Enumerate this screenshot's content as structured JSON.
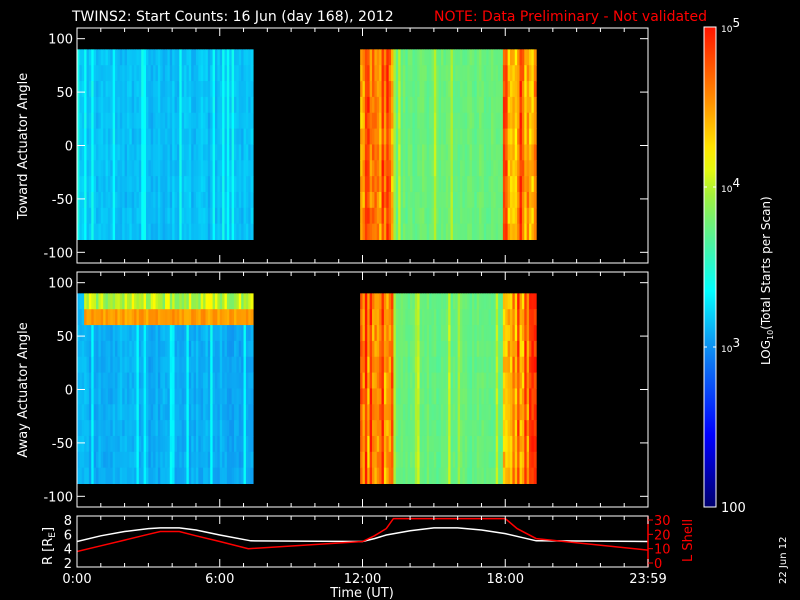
{
  "header": {
    "title": "TWINS2: Start Counts: 16 Jun (day 168), 2012",
    "note": "NOTE: Data Preliminary - Not validated"
  },
  "side_date": "22 Jun 12",
  "colors": {
    "background": "#000000",
    "note": "#ff0000",
    "axis": "#ffffff",
    "lshell": "#ff0000",
    "radius": "#ffffff"
  },
  "chart_data": [
    {
      "type": "heatmap",
      "name": "toward",
      "ylabel": "Toward Actuator Angle",
      "ylim": [
        -110,
        110
      ],
      "yticks": [
        "100",
        "50",
        "0",
        "-50",
        "-100"
      ],
      "ytick_values": [
        100,
        50,
        0,
        -50,
        -100
      ],
      "data_angle_range": [
        -88,
        90
      ],
      "xlim_hours": [
        0,
        24
      ],
      "segments": [
        {
          "start": 0.0,
          "end": 7.35,
          "log_counts": 3.15,
          "note": "blue-cyan"
        },
        {
          "start": 11.9,
          "end": 13.3,
          "log_counts": 4.6,
          "note": "orange stripes"
        },
        {
          "start": 13.3,
          "end": 17.9,
          "log_counts": 3.75,
          "note": "green"
        },
        {
          "start": 17.9,
          "end": 19.3,
          "log_counts": 4.6,
          "note": "orange stripes"
        }
      ]
    },
    {
      "type": "heatmap",
      "name": "away",
      "ylabel": "Away Actuator Angle",
      "ylim": [
        -110,
        110
      ],
      "yticks": [
        "100",
        "50",
        "0",
        "-50",
        "-100"
      ],
      "ytick_values": [
        100,
        50,
        0,
        -50,
        -100
      ],
      "data_angle_range": [
        -88,
        90
      ],
      "xlim_hours": [
        0,
        24
      ],
      "segments": [
        {
          "start": 0.0,
          "end": 7.35,
          "log_counts": 3.1,
          "note": "blue, bright band near 75 deg"
        },
        {
          "start": 11.9,
          "end": 13.3,
          "log_counts": 4.6,
          "note": "orange stripes"
        },
        {
          "start": 13.3,
          "end": 17.9,
          "log_counts": 3.75,
          "note": "green"
        },
        {
          "start": 17.9,
          "end": 19.3,
          "log_counts": 4.6,
          "note": "orange stripes"
        }
      ],
      "band": {
        "angle": 75,
        "start": 0.3,
        "end": 7.35,
        "log_counts": 4.6
      }
    },
    {
      "type": "line",
      "xlabel": "Time (UT)",
      "xticks": [
        "0:00",
        "6:00",
        "12:00",
        "18:00",
        "23:59"
      ],
      "xtick_values": [
        0,
        6,
        12,
        18,
        24
      ],
      "ylabel": "R [R",
      "ylabel_sub": "E",
      "ylabel_end": "]",
      "ylim": [
        2,
        8
      ],
      "yticks": [
        "8",
        "6",
        "4",
        "2"
      ],
      "ytick_values": [
        8,
        6,
        4,
        2
      ],
      "y2label": "L Shell",
      "y2lim": [
        0,
        30
      ],
      "y2ticks": [
        "30",
        "20",
        "10",
        "0"
      ],
      "y2tick_values": [
        30,
        20,
        10,
        0
      ],
      "series": [
        {
          "name": "R",
          "color": "#ffffff",
          "axis": "left",
          "x": [
            0,
            1,
            2,
            3,
            3.5,
            4.3,
            5,
            6,
            7.3,
            12,
            12.5,
            13,
            14,
            15,
            16,
            17,
            18,
            19.3,
            24
          ],
          "y": [
            5,
            5.8,
            6.4,
            6.8,
            6.9,
            6.9,
            6.6,
            5.9,
            5.1,
            5.0,
            5.4,
            5.9,
            6.5,
            6.9,
            6.9,
            6.6,
            6.1,
            5.1,
            5.0
          ]
        },
        {
          "name": "L Shell",
          "color": "#ff0000",
          "axis": "right",
          "x": [
            0,
            1,
            2,
            3,
            3.5,
            4.3,
            5,
            6,
            7.2,
            12,
            12.5,
            13,
            13.3,
            18,
            18.5,
            19.3,
            24
          ],
          "y": [
            8,
            12,
            16,
            20,
            22,
            22,
            19,
            15,
            10,
            15,
            19,
            24,
            31,
            31,
            24,
            17,
            9
          ]
        }
      ]
    },
    {
      "type": "colorbar",
      "label_prefix": "LOG",
      "label_sub": "10",
      "label_suffix": "(Total Starts per Scan)",
      "ticks": [
        {
          "base": "10",
          "exp": "5",
          "log": 5
        },
        {
          "base": "10",
          "exp": "4",
          "log": 4
        },
        {
          "base": "10",
          "exp": "3",
          "log": 3
        },
        {
          "base": "100",
          "exp": "",
          "log": 2
        }
      ],
      "range_log": [
        2,
        5
      ]
    }
  ]
}
